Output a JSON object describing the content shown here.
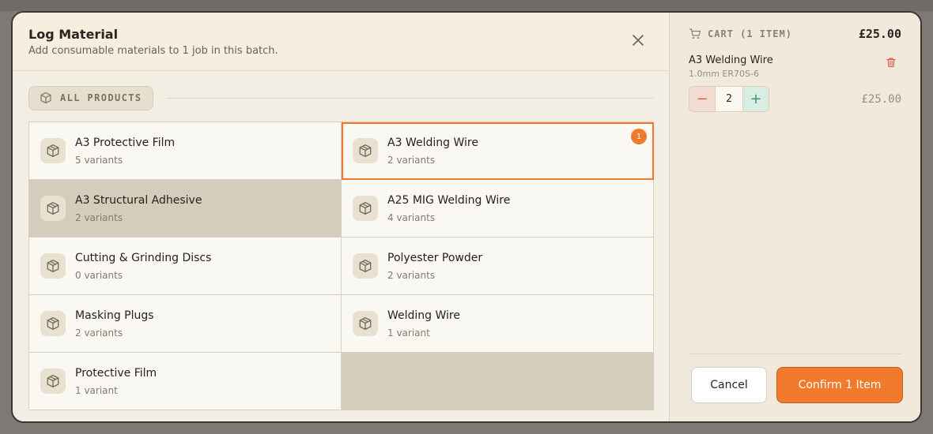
{
  "modal": {
    "title": "Log Material",
    "subtitle": "Add consumable materials to 1 job in this batch."
  },
  "filter": {
    "label": "ALL PRODUCTS"
  },
  "products": [
    {
      "name": "A3 Protective Film",
      "variants": "5 variants"
    },
    {
      "name": "A3 Welding Wire",
      "variants": "2 variants",
      "badge": "1"
    },
    {
      "name": "A3 Structural Adhesive",
      "variants": "2 variants"
    },
    {
      "name": "A25 MIG Welding Wire",
      "variants": "4 variants"
    },
    {
      "name": "Cutting & Grinding Discs",
      "variants": "0 variants"
    },
    {
      "name": "Polyester Powder",
      "variants": "2 variants"
    },
    {
      "name": "Masking Plugs",
      "variants": "2 variants"
    },
    {
      "name": "Welding Wire",
      "variants": "1 variant"
    },
    {
      "name": "Protective Film",
      "variants": "1 variant"
    }
  ],
  "cart": {
    "title": "CART (1 ITEM)",
    "total": "£25.00",
    "item": {
      "name": "A3 Welding Wire",
      "sub": "1.0mm ER70S-6",
      "quantity": "2",
      "minus": "−",
      "plus": "+",
      "price": "£25.00"
    }
  },
  "actions": {
    "cancel": "Cancel",
    "confirm": "Confirm 1 Item"
  },
  "colors": {
    "accent": "#f27a2c",
    "danger": "#e0604a",
    "success": "#3c9a68"
  }
}
